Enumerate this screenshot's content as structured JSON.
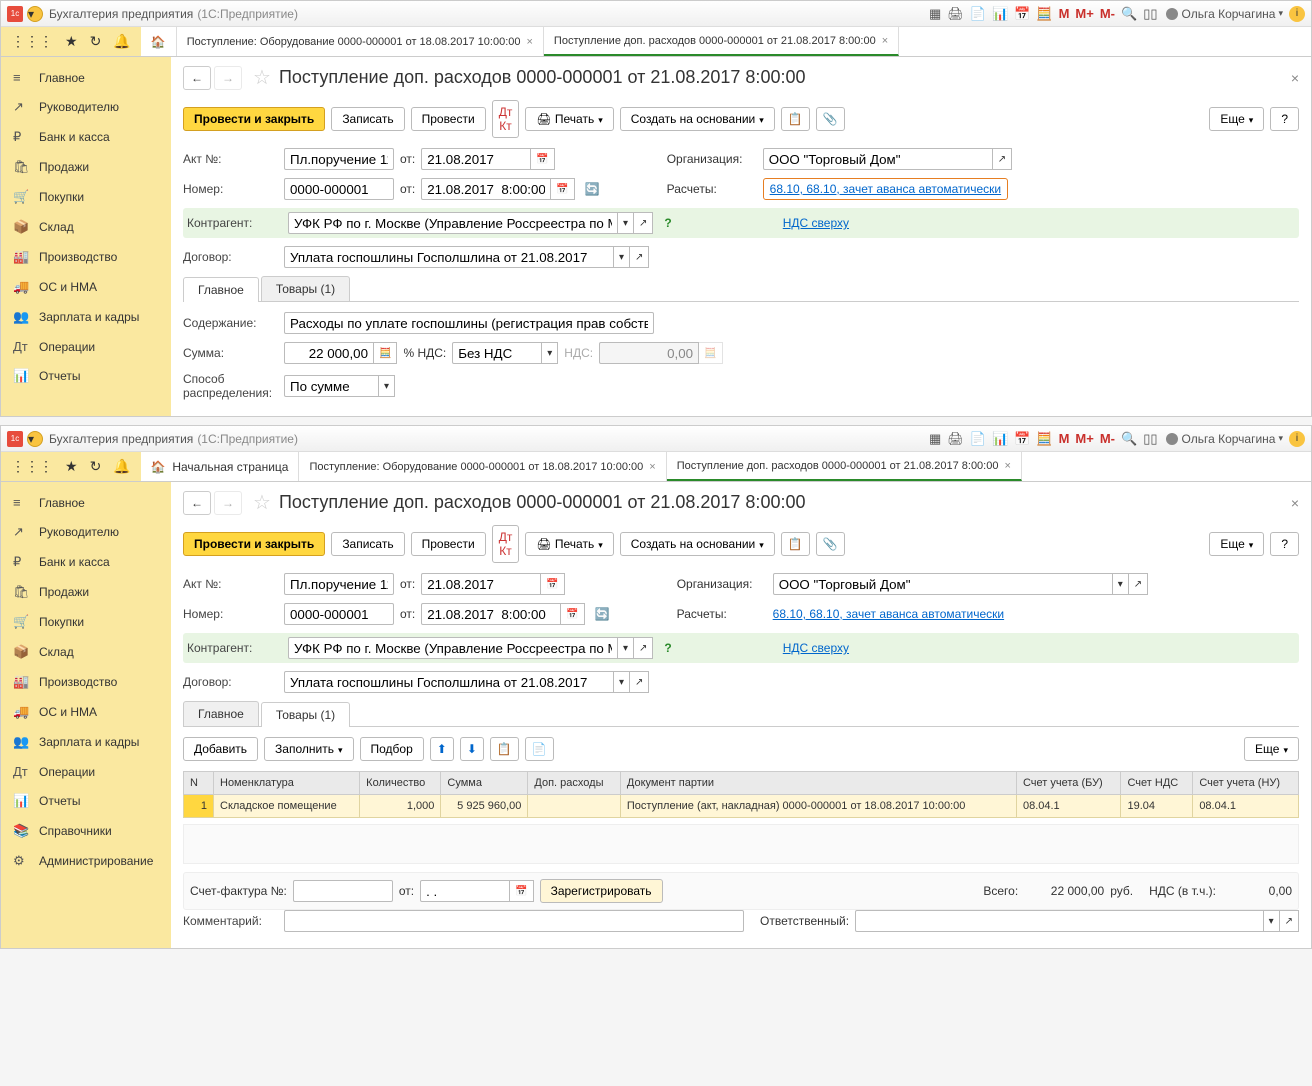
{
  "app": {
    "title": "Бухгалтерия предприятия",
    "subtitle": "(1С:Предприятие)",
    "user": "Ольга Корчагина"
  },
  "tb_icons": {
    "m": "M",
    "mplus": "M+",
    "mminus": "M-"
  },
  "tabs_top1": {
    "t1": "Поступление: Оборудование 0000-000001 от 18.08.2017 10:00:00",
    "t2": "Поступление доп. расходов 0000-000001 от 21.08.2017 8:00:00"
  },
  "tabs_top2": {
    "home": "Начальная страница",
    "t1": "Поступление: Оборудование 0000-000001 от 18.08.2017 10:00:00",
    "t2": "Поступление доп. расходов 0000-000001 от 21.08.2017 8:00:00"
  },
  "sidebar1": [
    {
      "icon": "≡",
      "label": "Главное"
    },
    {
      "icon": "↗",
      "label": "Руководителю"
    },
    {
      "icon": "₽",
      "label": "Банк и касса"
    },
    {
      "icon": "🛍",
      "label": "Продажи"
    },
    {
      "icon": "🛒",
      "label": "Покупки"
    },
    {
      "icon": "📦",
      "label": "Склад"
    },
    {
      "icon": "🏭",
      "label": "Производство"
    },
    {
      "icon": "🚚",
      "label": "ОС и НМА"
    },
    {
      "icon": "👥",
      "label": "Зарплата и кадры"
    },
    {
      "icon": "Дт",
      "label": "Операции"
    },
    {
      "icon": "📊",
      "label": "Отчеты"
    }
  ],
  "sidebar2_extra": [
    {
      "icon": "📚",
      "label": "Справочники"
    },
    {
      "icon": "⚙",
      "label": "Администрирование"
    }
  ],
  "page": {
    "title": "Поступление доп. расходов 0000-000001 от 21.08.2017 8:00:00"
  },
  "actions": {
    "post_close": "Провести и закрыть",
    "save": "Записать",
    "post": "Провести",
    "print": "Печать",
    "create_based": "Создать на основании",
    "more": "Еще",
    "help": "?"
  },
  "form": {
    "act_label": "Акт №:",
    "act_val": "Пл.поручение 11",
    "ot": "от:",
    "act_date": "21.08.2017",
    "num_label": "Номер:",
    "num_val": "0000-000001",
    "num_date": "21.08.2017  8:00:00",
    "org_label": "Организация:",
    "org_val": "ООО \"Торговый Дом\"",
    "calc_label": "Расчеты:",
    "calc_link": "68.10, 68.10, зачет аванса автоматически",
    "vat_link": "НДС сверху",
    "contr_label": "Контрагент:",
    "contr_val": "УФК РФ по г. Москве (Управление Россреестра по Москв",
    "dog_label": "Договор:",
    "dog_val": "Уплата госпошлины Госполшлина от 21.08.2017"
  },
  "inner_tabs": {
    "main": "Главное",
    "goods": "Товары (1)"
  },
  "main_tab": {
    "content_label": "Содержание:",
    "content_val": "Расходы по уплате госпошлины (регистрация прав собственнос",
    "sum_label": "Сумма:",
    "sum_val": "22 000,00",
    "vat_pct_label": "% НДС:",
    "vat_pct_val": "Без НДС",
    "vat_label": "НДС:",
    "vat_val": "0,00",
    "dist_label1": "Способ",
    "dist_label2": "распределения:",
    "dist_val": "По сумме"
  },
  "goods_actions": {
    "add": "Добавить",
    "fill": "Заполнить",
    "pick": "Подбор",
    "more": "Еще"
  },
  "goods_table": {
    "headers": {
      "n": "N",
      "nomen": "Номенклатура",
      "qty": "Количество",
      "sum": "Сумма",
      "extra": "Доп. расходы",
      "batch": "Документ партии",
      "acc_bu": "Счет учета (БУ)",
      "acc_vat": "Счет НДС",
      "acc_nu": "Счет учета (НУ)"
    },
    "row": {
      "n": "1",
      "nomen": "Складское помещение",
      "qty": "1,000",
      "sum": "5 925 960,00",
      "extra": "",
      "batch": "Поступление (акт, накладная) 0000-000001 от 18.08.2017 10:00:00",
      "acc_bu": "08.04.1",
      "acc_vat": "19.04",
      "acc_nu": "08.04.1"
    }
  },
  "footer": {
    "sf_label": "Счет-фактура №:",
    "ot": "от:",
    "sf_date": ". .",
    "register": "Зарегистрировать",
    "total_label": "Всего:",
    "total_val": "22 000,00",
    "curr": "руб.",
    "vat_incl_label": "НДС (в т.ч.):",
    "vat_incl_val": "0,00",
    "comment_label": "Комментарий:",
    "resp_label": "Ответственный:"
  }
}
